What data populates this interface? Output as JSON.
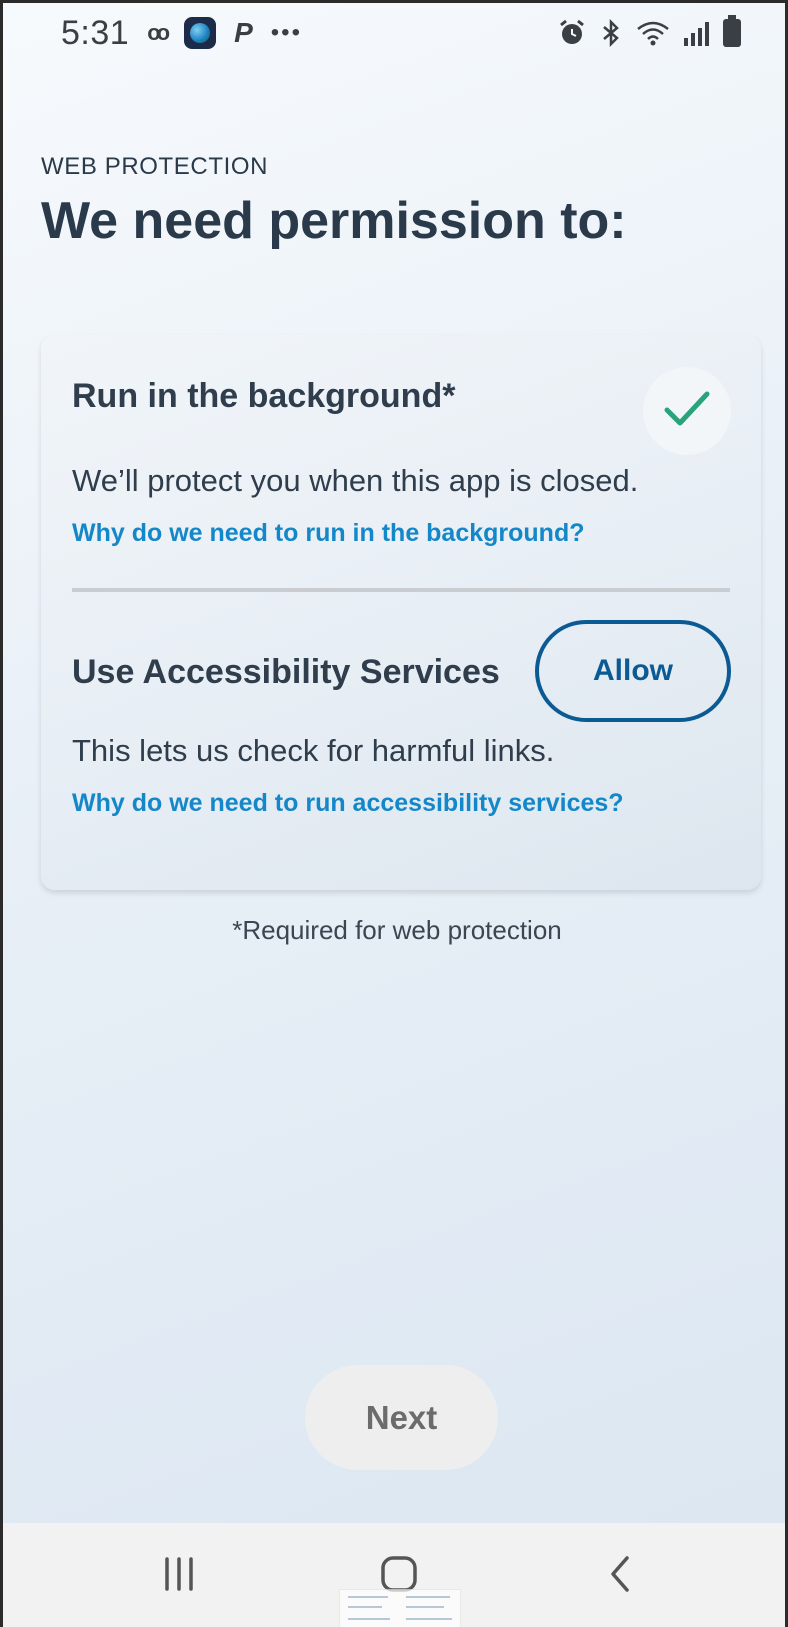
{
  "status_bar": {
    "time": "5:31",
    "left_icons": [
      "voicemail-icon",
      "app-globe-icon",
      "paypal-icon",
      "more-notifications-icon"
    ],
    "right_icons": [
      "alarm-icon",
      "bluetooth-icon",
      "wifi-icon",
      "signal-icon",
      "battery-icon"
    ]
  },
  "header": {
    "eyebrow": "WEB PROTECTION",
    "title": "We need permission to:"
  },
  "permissions": [
    {
      "title": "Run in the background*",
      "description": "We’ll protect you when this app is closed.",
      "link": "Why do we need to run in the background?",
      "status": "granted",
      "status_icon": "checkmark-icon",
      "accent": "#2aa37a"
    },
    {
      "title": "Use Accessibility Services",
      "description": "This lets us check for harmful links.",
      "link": "Why do we need to run accessibility services?",
      "action_label": "Allow",
      "status": "not-granted",
      "accent": "#0c5a94"
    }
  ],
  "footnote": "*Required for web protection",
  "next_label": "Next",
  "next_enabled": false,
  "nav_bar": {
    "buttons": [
      "recents-icon",
      "home-icon",
      "back-icon"
    ]
  },
  "colors": {
    "link": "#1487c9",
    "text": "#2a3a4a",
    "primary": "#0c5a94"
  }
}
